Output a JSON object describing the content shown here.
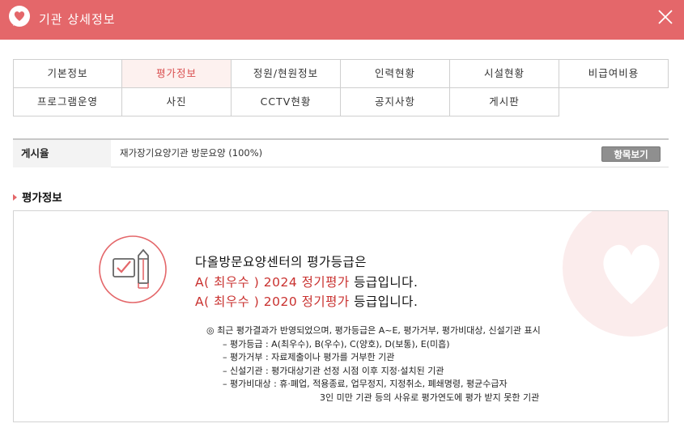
{
  "window": {
    "title": "기관 상세정보",
    "logo_icon": "heart-logo-icon",
    "close_icon": "close-icon",
    "brand_color": "#e4676a"
  },
  "tabs": [
    {
      "label": "기본정보",
      "active": false
    },
    {
      "label": "평가정보",
      "active": true
    },
    {
      "label": "정원/현원정보",
      "active": false
    },
    {
      "label": "인력현황",
      "active": false
    },
    {
      "label": "시설현황",
      "active": false
    },
    {
      "label": "비급여비용",
      "active": false
    },
    {
      "label": "프로그램운영",
      "active": false
    },
    {
      "label": "사진",
      "active": false
    },
    {
      "label": "CCTV현황",
      "active": false
    },
    {
      "label": "공지사항",
      "active": false
    },
    {
      "label": "게시판",
      "active": false
    }
  ],
  "posting": {
    "label": "게시율",
    "value": "재가장기요양기관 방문요양 (100%)",
    "button": "항목보기"
  },
  "section": {
    "title": "평가정보"
  },
  "evaluation": {
    "icon": "checklist-pencil-icon",
    "headline": "다올방문요양센터의 평가등급은",
    "results": [
      {
        "grade": "A( 최우수 )",
        "year_type": "2024 정기평가",
        "suffix": "등급입니다."
      },
      {
        "grade": "A( 최우수 )",
        "year_type": "2020 정기평가",
        "suffix": "등급입니다."
      }
    ],
    "notes": {
      "intro": "◎ 최근 평가결과가 반영되었으며, 평가등급은 A~E, 평가거부, 평가비대상, 신설기관 표시",
      "grades": "– 평가등급 : A(최우수), B(우수), C(양호), D(보통), E(미흡)",
      "refused": "– 평가거부 : 자료제출이나 평가를 거부한 기관",
      "new": "– 신설기관 : 평가대상기관 선정 시점 이후 지정·설치된 기관",
      "excluded": "– 평가비대상 : 휴·폐업, 적용종료, 업무정지, 지정취소, 폐쇄명령, 평균수급자",
      "excluded2": "3인 미만 기관 등의 사유로 평가연도에 평가 받지 못한 기관"
    }
  }
}
